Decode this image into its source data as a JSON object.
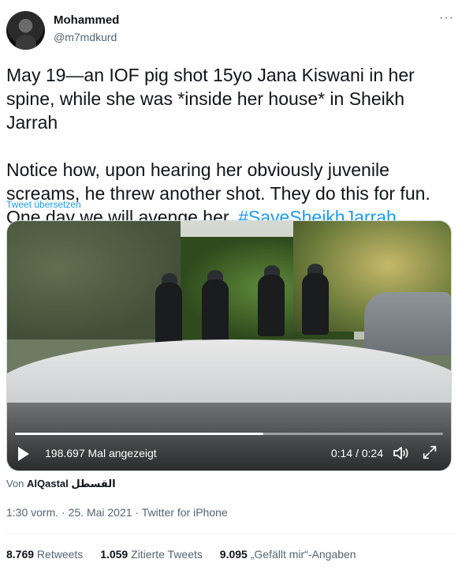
{
  "author": {
    "name": "Mohammed",
    "handle": "@m7mdkurd"
  },
  "more_label": "···",
  "tweet": {
    "paragraph1": "May 19—an IOF pig shot 15yo Jana Kiswani in her spine, while she was *inside her house* in Sheikh Jarrah",
    "paragraph2_text": "Notice how, upon hearing her obviously juvenile screams, he threw another shot. They do this for fun. One day we will avenge her. ",
    "hashtag": "#SaveSheikhJarrah",
    "translate_label": "Tweet übersetzen"
  },
  "video": {
    "views": "198.697 Mal angezeigt",
    "time": "0:14 / 0:24",
    "progress": 0.58
  },
  "source": {
    "prefix": "Von ",
    "name": "AlQastal القسطل"
  },
  "meta": {
    "time": "1:30 vorm.",
    "sep1": " · ",
    "date": "25. Mai 2021",
    "sep2": " · ",
    "client": "Twitter for iPhone"
  },
  "stats": {
    "retweets_count": "8.769",
    "retweets_label": " Retweets",
    "quotes_count": "1.059",
    "quotes_label": " Zitierte Tweets",
    "likes_count": "9.095",
    "likes_label": " „Gefällt mir“-Angaben"
  },
  "colors": {
    "accent": "#1d9bf0",
    "secondary_text": "#536471"
  }
}
